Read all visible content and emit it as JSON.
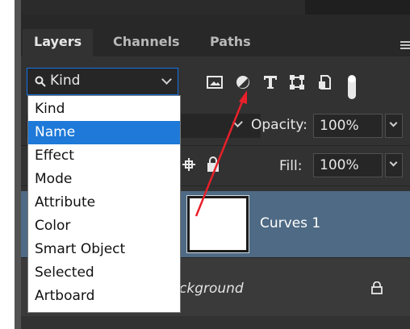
{
  "panel": {
    "tabs": [
      {
        "label": "Layers",
        "active": true
      },
      {
        "label": "Channels",
        "active": false
      },
      {
        "label": "Paths",
        "active": false
      }
    ],
    "menu_icon": "panel-menu-icon"
  },
  "filter": {
    "kind_select_value": "Kind",
    "icons": [
      "pixel-layer-filter-icon",
      "adjustment-layer-filter-icon",
      "type-layer-filter-icon",
      "shape-layer-filter-icon",
      "smart-object-filter-icon",
      "filter-toggle-icon"
    ]
  },
  "dropdown": {
    "items": [
      "Kind",
      "Name",
      "Effect",
      "Mode",
      "Attribute",
      "Color",
      "Smart Object",
      "Selected",
      "Artboard"
    ],
    "selected": "Name"
  },
  "blend": {
    "opacity_label": "Opacity:",
    "opacity_value": "100%",
    "fill_label": "Fill:",
    "fill_value": "100%"
  },
  "layers": [
    {
      "name": "Curves 1",
      "selected": true
    },
    {
      "name": "ckground",
      "locked": true
    }
  ],
  "colors": {
    "panel_bg": "#323232",
    "selected_row": "#4e6a84",
    "accent_blue": "#1473e6",
    "annotation_red": "#e8202a"
  }
}
